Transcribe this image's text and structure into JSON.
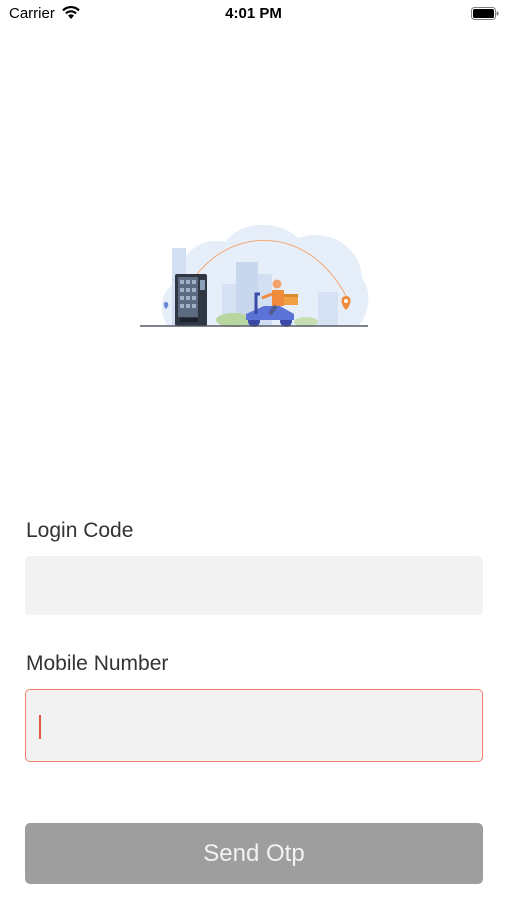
{
  "status_bar": {
    "carrier": "Carrier",
    "time": "4:01 PM",
    "icons": [
      "wifi-icon",
      "battery-icon"
    ]
  },
  "illustration": {
    "icon": "delivery-scooter-illustration"
  },
  "form": {
    "login_code_label": "Login Code",
    "login_code_value": "",
    "mobile_number_label": "Mobile Number",
    "mobile_number_value": "",
    "send_button_label": "Send Otp"
  },
  "colors": {
    "field_background": "#f2f2f2",
    "focus_border": "#f0826a",
    "caret": "#e05a3e",
    "button_disabled": "#9e9e9e",
    "button_text": "#f2f2f2"
  }
}
